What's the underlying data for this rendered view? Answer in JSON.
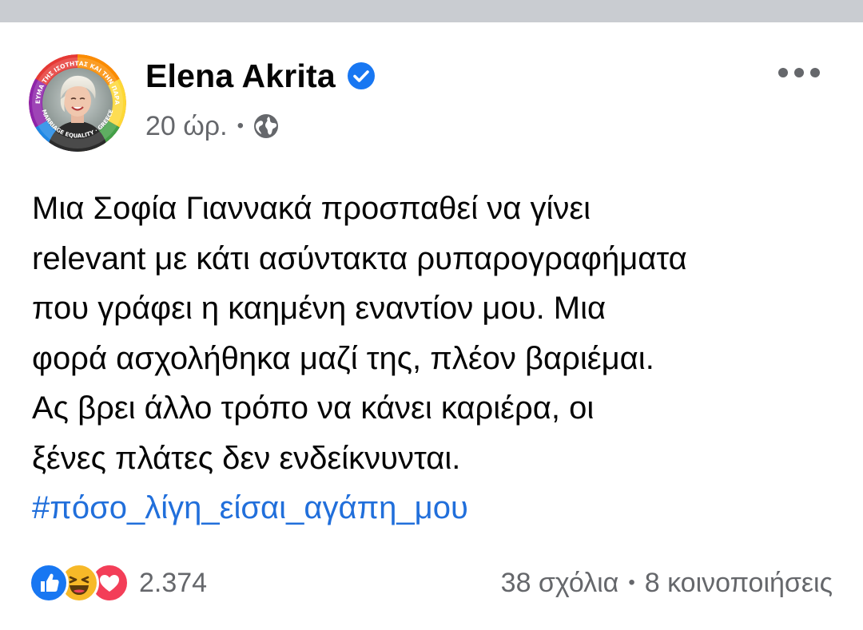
{
  "post": {
    "author": {
      "name": "Elena Akrita",
      "verified": true,
      "avatar_ring_text": [
        "ΣΤΟ ΡΕΥΜΑ ΤΗΣ ΙΣΟΤΗΤΑΣ ΚΑΙ ΤΗΝ ΠΑΡΑΔΟΣΗ",
        "MARRIAGE EQUALITY · GREECE"
      ]
    },
    "timestamp": "20 ώρ.",
    "meta_separator": "•",
    "audience_icon": "globe-icon",
    "more_icon": "more-options-icon",
    "text_lines": [
      "Μια Σοφία Γιαννακά προσπαθεί να γίνει",
      "relevant με κάτι ασύντακτα ρυπαρογραφήματα",
      "που γράφει η καημένη εναντίον μου. Μια",
      "φορά ασχολήθηκα μαζί της, πλέον βαριέμαι.",
      "Ας βρει άλλο τρόπο να κάνει καριέρα, οι",
      "ξένες πλάτες δεν ενδείκνυνται."
    ],
    "hashtag": "#πόσο_λίγη_είσαι_αγάπη_μου"
  },
  "footer": {
    "reaction_icons": [
      "like-icon",
      "haha-icon",
      "love-icon"
    ],
    "reaction_count": "2.374",
    "comments": "38 σχόλια",
    "separator": "•",
    "shares": "8 κοινοποιήσεις"
  },
  "colors": {
    "text_primary": "#050505",
    "text_secondary": "#65676b",
    "link": "#216fdb",
    "verified_badge": "#1877f2",
    "like_blue": "#1877f2",
    "love_red": "#f33e58",
    "haha_yellow": "#f7b928",
    "top_strip": "#c9ccd1"
  }
}
